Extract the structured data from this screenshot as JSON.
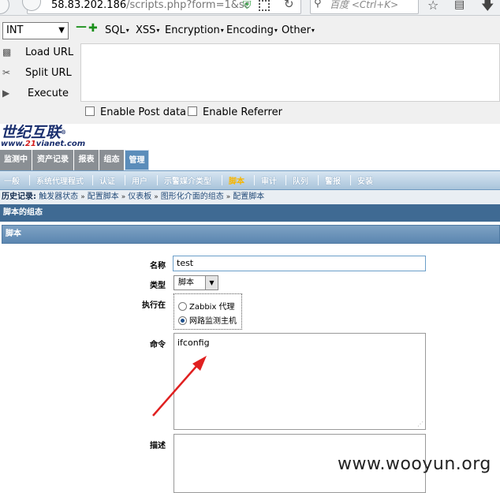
{
  "browser": {
    "url_host": "58.83.202.186",
    "url_rest": "/scripts.php?form=1&sc",
    "search_placeholder": "百度 <Ctrl+K>"
  },
  "hackbar": {
    "select_value": "INT",
    "menus": [
      "SQL",
      "XSS",
      "Encryption",
      "Encoding",
      "Other"
    ],
    "load_url": "Load URL",
    "split_url": "Split URL",
    "execute": "Execute",
    "enable_post": "Enable Post data",
    "enable_referrer": "Enable Referrer"
  },
  "logo": {
    "name": "世纪互联",
    "reg": "®",
    "domain_prefix": "www.",
    "domain_red": "21",
    "domain_suffix": "vianet.com"
  },
  "topnav": [
    "监测中",
    "资产记录",
    "报表",
    "组态",
    "管理"
  ],
  "subnav": [
    "一般",
    "系统代理程式",
    "认证",
    "用户",
    "示警媒介类型",
    "脚本",
    "审计",
    "队列",
    "警报",
    "安装"
  ],
  "history": {
    "label": "历史记录:",
    "items": [
      "触发器状态",
      "配置脚本",
      "仪表板",
      "图形化介面的组态",
      "配置脚本"
    ]
  },
  "section_title": "脚本的组态",
  "form_header": "脚本",
  "form": {
    "name_label": "名称",
    "name_value": "test",
    "type_label": "类型",
    "type_value": "脚本",
    "exec_label": "执行在",
    "exec_options": [
      "Zabbix 代理",
      "网路监测主机"
    ],
    "exec_selected": 1,
    "command_label": "命令",
    "command_value": "ifconfig",
    "desc_label": "描述"
  },
  "watermark": "www.wooyun.org",
  "colors": {
    "nav_active": "#5b8dba",
    "header_blue": "#3f6a93",
    "arrow_red": "#e02020"
  }
}
